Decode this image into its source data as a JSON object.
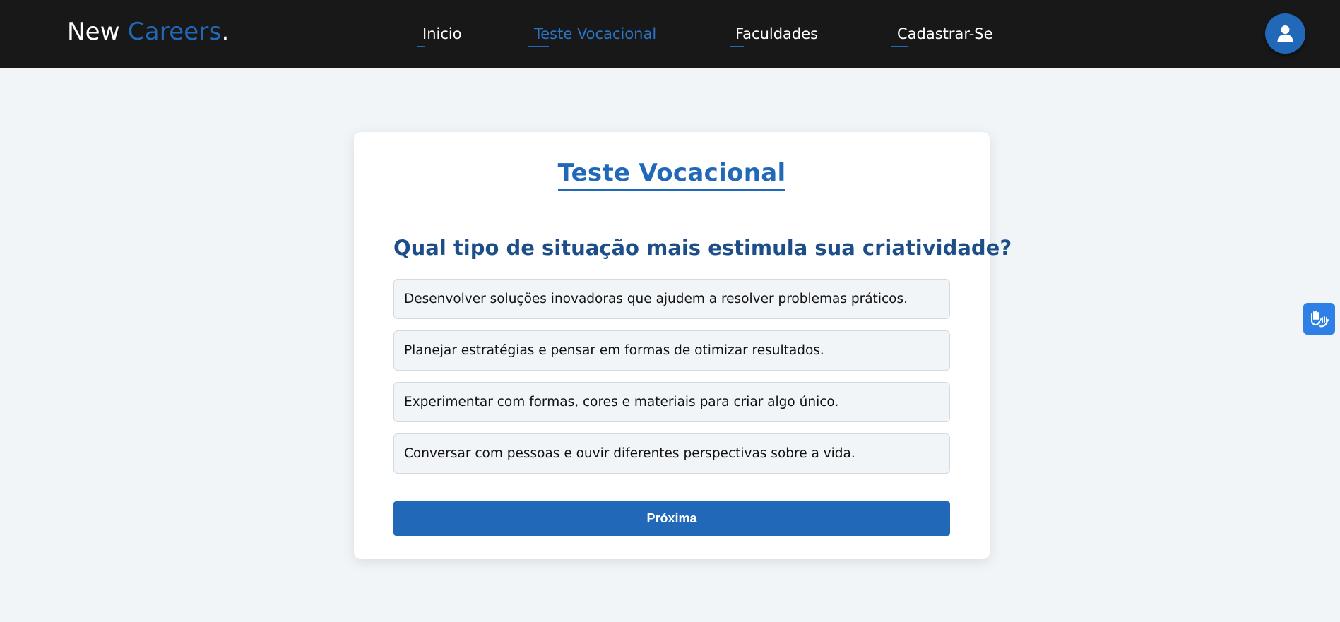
{
  "brand": {
    "part1": "New ",
    "part2": "Careers",
    "dot": "."
  },
  "nav": {
    "items": [
      {
        "label": "Inicio",
        "active": false
      },
      {
        "label": "Teste Vocacional",
        "active": true
      },
      {
        "label": "Faculdades",
        "active": false
      },
      {
        "label": "Cadastrar-Se",
        "active": false
      }
    ],
    "profile_icon": "user-icon"
  },
  "quiz": {
    "title": "Teste Vocacional",
    "question": "Qual tipo de situação mais estimula sua criatividade?",
    "options": [
      "Desenvolver soluções inovadoras que ajudem a resolver problemas práticos.",
      "Planejar estratégias e pensar em formas de otimizar resultados.",
      "Experimentar com formas, cores e materiais para criar algo único.",
      "Conversar com pessoas e ouvir diferentes perspectivas sobre a vida."
    ],
    "next_label": "Próxima"
  },
  "accessibility": {
    "icon": "sign-language-hands-icon"
  },
  "colors": {
    "navbar_bg": "#181818",
    "accent": "#2168b8",
    "page_bg": "#f1f5f8",
    "question_text": "#1c4e8a",
    "a11y_button": "#2f80e6"
  }
}
